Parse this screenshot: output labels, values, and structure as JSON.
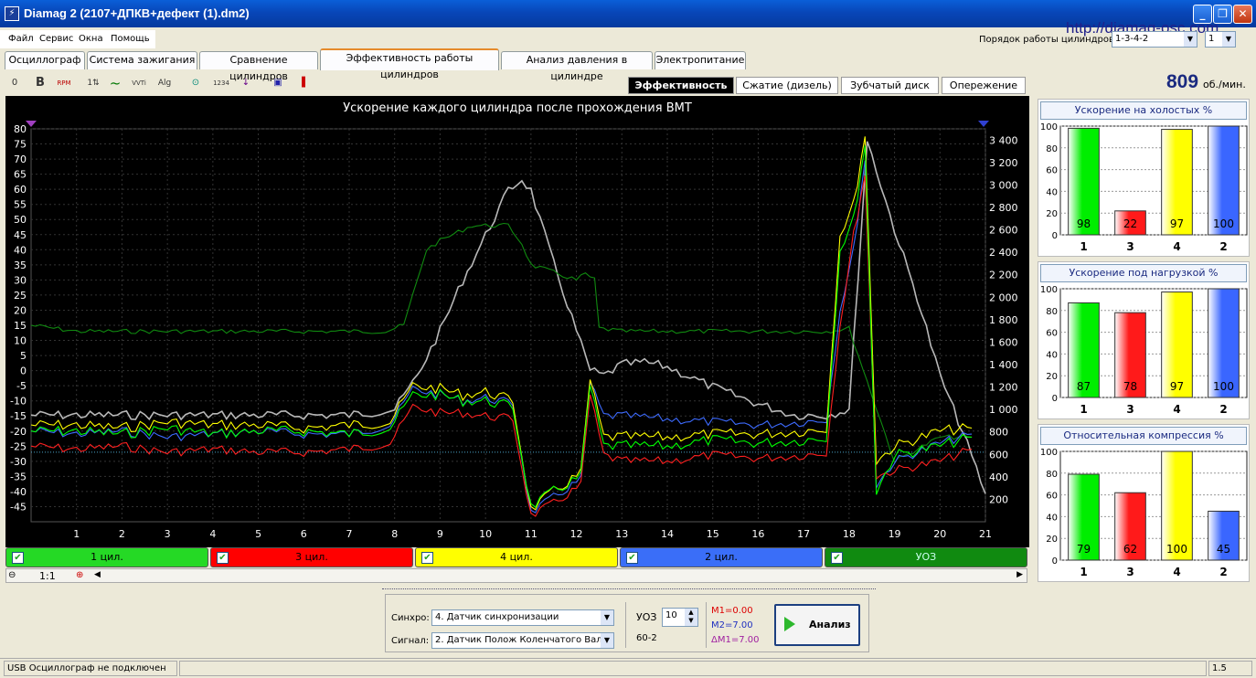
{
  "window": {
    "title": "Diamag 2 (2107+ДПКВ+дефект (1).dm2)",
    "icon": "oscilloscope-app-icon",
    "buttons": [
      "minimize-icon",
      "restore-icon",
      "close-icon"
    ]
  },
  "menu": [
    "Файл",
    "Сервис",
    "Окна",
    "Помощь"
  ],
  "url": "http://diamag-osc.com",
  "firing_order": {
    "label": "Порядок работы цилиндров",
    "value": "1-3-4-2",
    "cylinder": "1"
  },
  "tabs": [
    "Осциллограф",
    "Система зажигания",
    "Сравнение цилиндров",
    "Эффективность работы цилиндров",
    "Анализ давления в цилиндре",
    "Электропитание"
  ],
  "active_tab": 3,
  "toolbar": [
    {
      "icon": "zero-icon",
      "text": "0"
    },
    {
      "icon": "bold-icon",
      "text": "B"
    },
    {
      "icon": "rpm-icon",
      "text": "RPM"
    },
    {
      "icon": "sort-icon",
      "text": "1⇅"
    },
    {
      "icon": "curve-icon",
      "text": "~"
    },
    {
      "icon": "vvti-icon",
      "text": "VVTi"
    },
    {
      "icon": "algorithm-icon",
      "text": "Alg"
    },
    {
      "icon": "sensor-icon",
      "text": "⊙"
    },
    {
      "icon": "numbering-icon",
      "text": "1234"
    },
    {
      "icon": "filter-icon",
      "text": "↓"
    },
    {
      "icon": "car-icon",
      "text": "▣"
    },
    {
      "icon": "bar-chart-icon",
      "text": "▐"
    }
  ],
  "subtabs": [
    "Эффективность",
    "Сжатие (дизель)",
    "Зубчатый диск",
    "Опережение"
  ],
  "active_subtab": 0,
  "rpm": {
    "value": "809",
    "unit": "об./мин."
  },
  "chart_data": {
    "type": "line",
    "title": "Ускорение каждого цилиндра после прохождения ВМТ",
    "xlim": [
      0,
      21
    ],
    "x_ticks": [
      "1",
      "2",
      "3",
      "4",
      "5",
      "6",
      "7",
      "8",
      "9",
      "10",
      "11",
      "12",
      "13",
      "14",
      "15",
      "16",
      "17",
      "18",
      "19",
      "20",
      "21"
    ],
    "ylim": [
      -50,
      80
    ],
    "y_ticks": [
      "80",
      "75",
      "70",
      "65",
      "60",
      "55",
      "50",
      "45",
      "40",
      "35",
      "30",
      "25",
      "20",
      "15",
      "10",
      "5",
      "0",
      "-5",
      "-10",
      "-15",
      "-20",
      "-25",
      "-30",
      "-35",
      "-40",
      "-45"
    ],
    "y2lim": [
      0,
      3500
    ],
    "y2_ticks": [
      "3 400",
      "3 200",
      "3 000",
      "2 800",
      "2 600",
      "2 400",
      "2 200",
      "2 000",
      "1 800",
      "1 600",
      "1 400",
      "1 200",
      "1 000",
      "800",
      "600",
      "400",
      "200"
    ],
    "reference_line": -27,
    "series": [
      {
        "name": "1 цил.",
        "color": "#00ff00",
        "axis": "left",
        "x": [
          0,
          1,
          2,
          3,
          4,
          5,
          6,
          7,
          7.9,
          8.4,
          9,
          9.5,
          10,
          10.6,
          11,
          11.5,
          12.1,
          12.3,
          12.6,
          13,
          14,
          15,
          16,
          17,
          17.5,
          17.8,
          18.1,
          18.35,
          18.6,
          19,
          20,
          20.7
        ],
        "y": [
          -20,
          -20,
          -21,
          -19,
          -21,
          -20,
          -20,
          -21,
          -19,
          -8,
          -8,
          -10,
          -10,
          -12,
          -45,
          -40,
          -35,
          -5,
          -25,
          -25,
          -25,
          -23,
          -24,
          -23,
          -22,
          40,
          50,
          75,
          -40,
          -28,
          -25,
          -22
        ]
      },
      {
        "name": "3 цил.",
        "color": "#ff2020",
        "axis": "left",
        "x": [
          0,
          1,
          2,
          3,
          4,
          5,
          6,
          7,
          7.9,
          8.4,
          9,
          9.5,
          10,
          10.6,
          11,
          11.5,
          12.1,
          12.3,
          12.6,
          13,
          14,
          15,
          16,
          17,
          17.5,
          17.8,
          18.1,
          18.35,
          18.6,
          19,
          20,
          20.7
        ],
        "y": [
          -25,
          -26,
          -25,
          -27,
          -26,
          -27,
          -27,
          -26,
          -24,
          -12,
          -14,
          -14,
          -15,
          -16,
          -48,
          -44,
          -38,
          -8,
          -28,
          -30,
          -30,
          -28,
          -29,
          -28,
          -27,
          15,
          45,
          65,
          -35,
          -33,
          -30,
          -26
        ]
      },
      {
        "name": "4 цил.",
        "color": "#ffff00",
        "axis": "left",
        "x": [
          0,
          1,
          2,
          3,
          4,
          5,
          6,
          7,
          7.9,
          8.4,
          9,
          9.5,
          10,
          10.6,
          11,
          11.5,
          12.1,
          12.3,
          12.6,
          13,
          14,
          15,
          16,
          17,
          17.5,
          17.8,
          18.1,
          18.35,
          18.6,
          19,
          20,
          20.7
        ],
        "y": [
          -18,
          -18,
          -19,
          -17,
          -18,
          -18,
          -19,
          -18,
          -17,
          -5,
          -6,
          -8,
          -7,
          -10,
          -46,
          -40,
          -34,
          -3,
          -22,
          -22,
          -22,
          -21,
          -21,
          -20,
          -19,
          45,
          55,
          78,
          -30,
          -25,
          -20,
          -19
        ]
      },
      {
        "name": "2 цил.",
        "color": "#3d6bff",
        "axis": "left",
        "x": [
          0,
          1,
          2,
          3,
          4,
          5,
          6,
          7,
          7.9,
          8.4,
          9,
          9.5,
          10,
          10.6,
          11,
          11.5,
          12.1,
          12.3,
          12.6,
          13,
          14,
          15,
          16,
          17,
          17.5,
          17.8,
          18.1,
          18.35,
          18.6,
          19,
          20,
          20.7
        ],
        "y": [
          -20,
          -21,
          -20,
          -22,
          -21,
          -20,
          -21,
          -21,
          -18,
          -6,
          -8,
          -10,
          -9,
          -11,
          -47,
          -42,
          -36,
          -4,
          -15,
          -15,
          -16,
          -17,
          -18,
          -17,
          -16,
          20,
          40,
          70,
          -38,
          -30,
          -24,
          -21
        ]
      },
      {
        "name": "УОЗ",
        "color": "#108a10",
        "axis": "left",
        "x": [
          0,
          1,
          2,
          3,
          4,
          5,
          6,
          7,
          7.8,
          8.2,
          8.7,
          9,
          9.7,
          10.5,
          10.8,
          11,
          12,
          12.2,
          12.4,
          12.5,
          13,
          14,
          15,
          16,
          17,
          17.5,
          18,
          19,
          20,
          20.7
        ],
        "y": [
          15,
          13,
          13,
          13,
          13,
          13,
          13,
          13,
          13,
          15,
          40,
          43,
          48,
          48,
          42,
          35,
          30,
          32,
          30,
          14,
          13,
          13,
          13,
          13,
          13,
          13,
          14,
          -30,
          -22,
          -22
        ]
      },
      {
        "name": "RPM",
        "color": "#b8b8b8",
        "axis": "right",
        "x": [
          0,
          1,
          2,
          3,
          4,
          5,
          6,
          7,
          8,
          8.5,
          9,
          9.5,
          10,
          10.5,
          10.8,
          11,
          11.5,
          12,
          12.3,
          12.6,
          13,
          13.5,
          14,
          15,
          16,
          16.8,
          17.5,
          18,
          18.4,
          18.7,
          19,
          19.5,
          20,
          20.5,
          21
        ],
        "y": [
          950,
          950,
          950,
          950,
          950,
          950,
          950,
          950,
          1000,
          1300,
          1700,
          2150,
          2550,
          2950,
          3050,
          2950,
          2300,
          1700,
          1350,
          1300,
          1400,
          1420,
          1380,
          1200,
          1050,
          950,
          950,
          1000,
          3400,
          3000,
          2600,
          2000,
          1300,
          800,
          250
        ]
      }
    ]
  },
  "chips": [
    {
      "label": "1 цил.",
      "color": "#25d925",
      "checked": "✔"
    },
    {
      "label": "3 цил.",
      "color": "#ff0000",
      "checked": "✔"
    },
    {
      "label": "4 цил.",
      "color": "#ffff00",
      "checked": "✔"
    },
    {
      "label": "2 цил.",
      "color": "#3a6ef8",
      "checked": "✔"
    },
    {
      "label": "УОЗ",
      "color": "#108a10",
      "checked": "✔"
    }
  ],
  "zoom": {
    "label": "1:1"
  },
  "side_charts": [
    {
      "title": "Ускорение на холостых %",
      "type": "bar",
      "categories": [
        "1",
        "3",
        "4",
        "2"
      ],
      "values": [
        98,
        22,
        97,
        100
      ],
      "labels": [
        "98",
        "22",
        "97",
        "100"
      ],
      "ylim": [
        0,
        100
      ],
      "y_ticks": [
        "100",
        "80",
        "60",
        "40",
        "20",
        "0"
      ]
    },
    {
      "title": "Ускорение под нагрузкой %",
      "type": "bar",
      "categories": [
        "1",
        "3",
        "4",
        "2"
      ],
      "values": [
        87,
        78,
        97,
        100
      ],
      "labels": [
        "87",
        "78",
        "97",
        "100"
      ],
      "ylim": [
        0,
        100
      ],
      "y_ticks": [
        "100",
        "80",
        "60",
        "40",
        "20",
        "0"
      ]
    },
    {
      "title": "Относительная компрессия %",
      "type": "bar",
      "categories": [
        "1",
        "3",
        "4",
        "2"
      ],
      "values": [
        79,
        62,
        100,
        45
      ],
      "labels": [
        "79",
        "62",
        "100",
        "45"
      ],
      "ylim": [
        0,
        100
      ],
      "y_ticks": [
        "100",
        "80",
        "60",
        "40",
        "20",
        "0"
      ]
    }
  ],
  "bar_colors": [
    "#00ee00",
    "#ff1a1a",
    "#ffff00",
    "#3a66ff"
  ],
  "bottom": {
    "sync_label": "Синхро:",
    "sync_value": "4.  Датчик синхронизации",
    "signal_label": "Сигнал:",
    "signal_value": "2.  Датчик Полож Коленчатого Вал",
    "uoz_label": "УОЗ",
    "uoz_value": "10",
    "teeth": "60-2",
    "m1": "M1=0.00",
    "m2": "M2=7.00",
    "dm1": "ΔM1=7.00",
    "analyze": "Анализ"
  },
  "status": {
    "text": "USB Осциллограф не подключен",
    "version": "1.5"
  }
}
